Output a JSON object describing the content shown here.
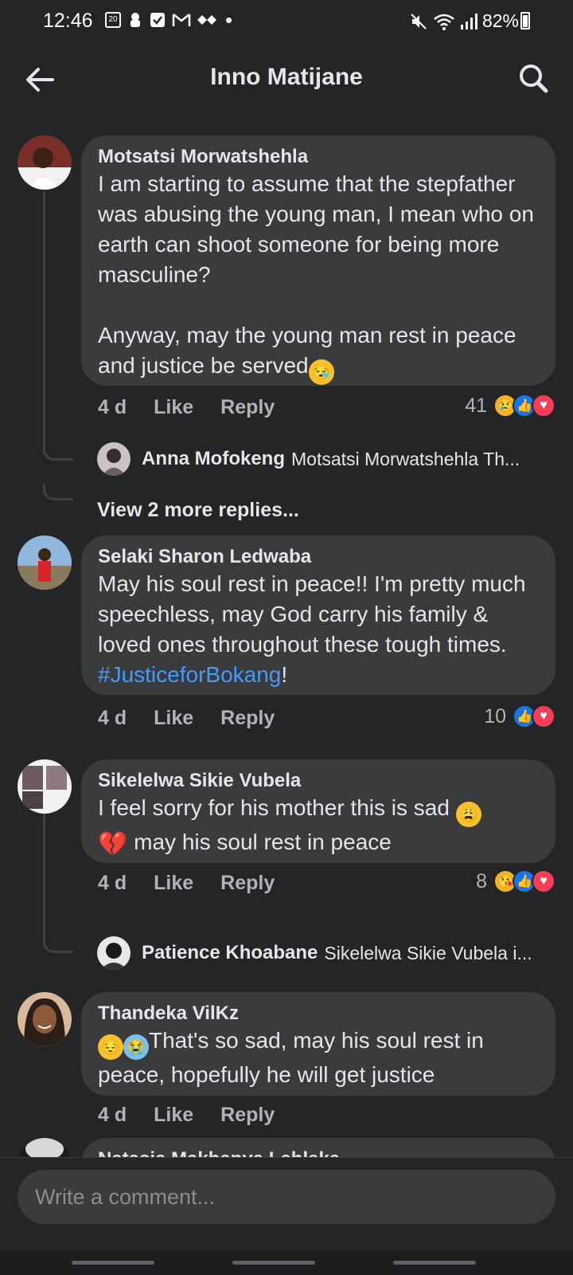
{
  "status_bar": {
    "time": "12:46",
    "left_icons": [
      "calendar-icon",
      "hand-icon",
      "checkbox-icon",
      "gmail-icon",
      "dots-icon"
    ],
    "calendar_day": "20",
    "battery": "82%"
  },
  "header": {
    "title": "Inno Matijane"
  },
  "comments": [
    {
      "author": "Motsatsi Morwatshehla",
      "text": "I am starting to assume that the stepfather was abusing the young man, I mean who on earth can shoot someone for being more masculine?\n\nAnyway, may the young man rest in peace and justice be served",
      "trailing_emoji": "😪",
      "time": "4 d",
      "like": "Like",
      "reply": "Reply",
      "reaction_count": "41",
      "reactions": [
        "sad",
        "like",
        "love"
      ],
      "replies": [
        {
          "author": "Anna Mofokeng",
          "preview": "Motsatsi Morwatshehla Th..."
        }
      ],
      "more_replies": "View 2 more replies..."
    },
    {
      "author": "Selaki Sharon Ledwaba",
      "text": "May his soul rest in peace!! I'm pretty much speechless, may God carry his family & loved ones throughout these tough times. ",
      "hashtag": "#JusticeforBokang",
      "after_hashtag": "!",
      "time": "4 d",
      "like": "Like",
      "reply": "Reply",
      "reaction_count": "10",
      "reactions": [
        "like",
        "love"
      ]
    },
    {
      "author": "Sikelelwa Sikie Vubela",
      "text_line1": "I feel sorry for his mother this is sad ",
      "emoji1": "😩",
      "emoji2": "💔",
      "text_line2": " may his soul rest in peace",
      "time": "4 d",
      "like": "Like",
      "reply": "Reply",
      "reaction_count": "8",
      "reactions": [
        "care",
        "like",
        "love"
      ],
      "replies": [
        {
          "author": "Patience Khoabane",
          "preview": "Sikelelwa Sikie Vubela i..."
        }
      ]
    },
    {
      "author": "Thandeka VilKz",
      "emoji1": "😔",
      "emoji2": "😭",
      "text": "That's so sad, may his soul rest in peace, hopefully he will get justice",
      "time": "4 d",
      "like": "Like",
      "reply": "Reply"
    },
    {
      "author": "Natasja Makhanya Lehlaka"
    }
  ],
  "composer": {
    "placeholder": "Write a comment..."
  },
  "colors": {
    "background": "#242526",
    "bubble": "#3a3b3c",
    "link": "#4599ff",
    "like_blue": "#1b74e4",
    "love_red": "#f33e58"
  }
}
